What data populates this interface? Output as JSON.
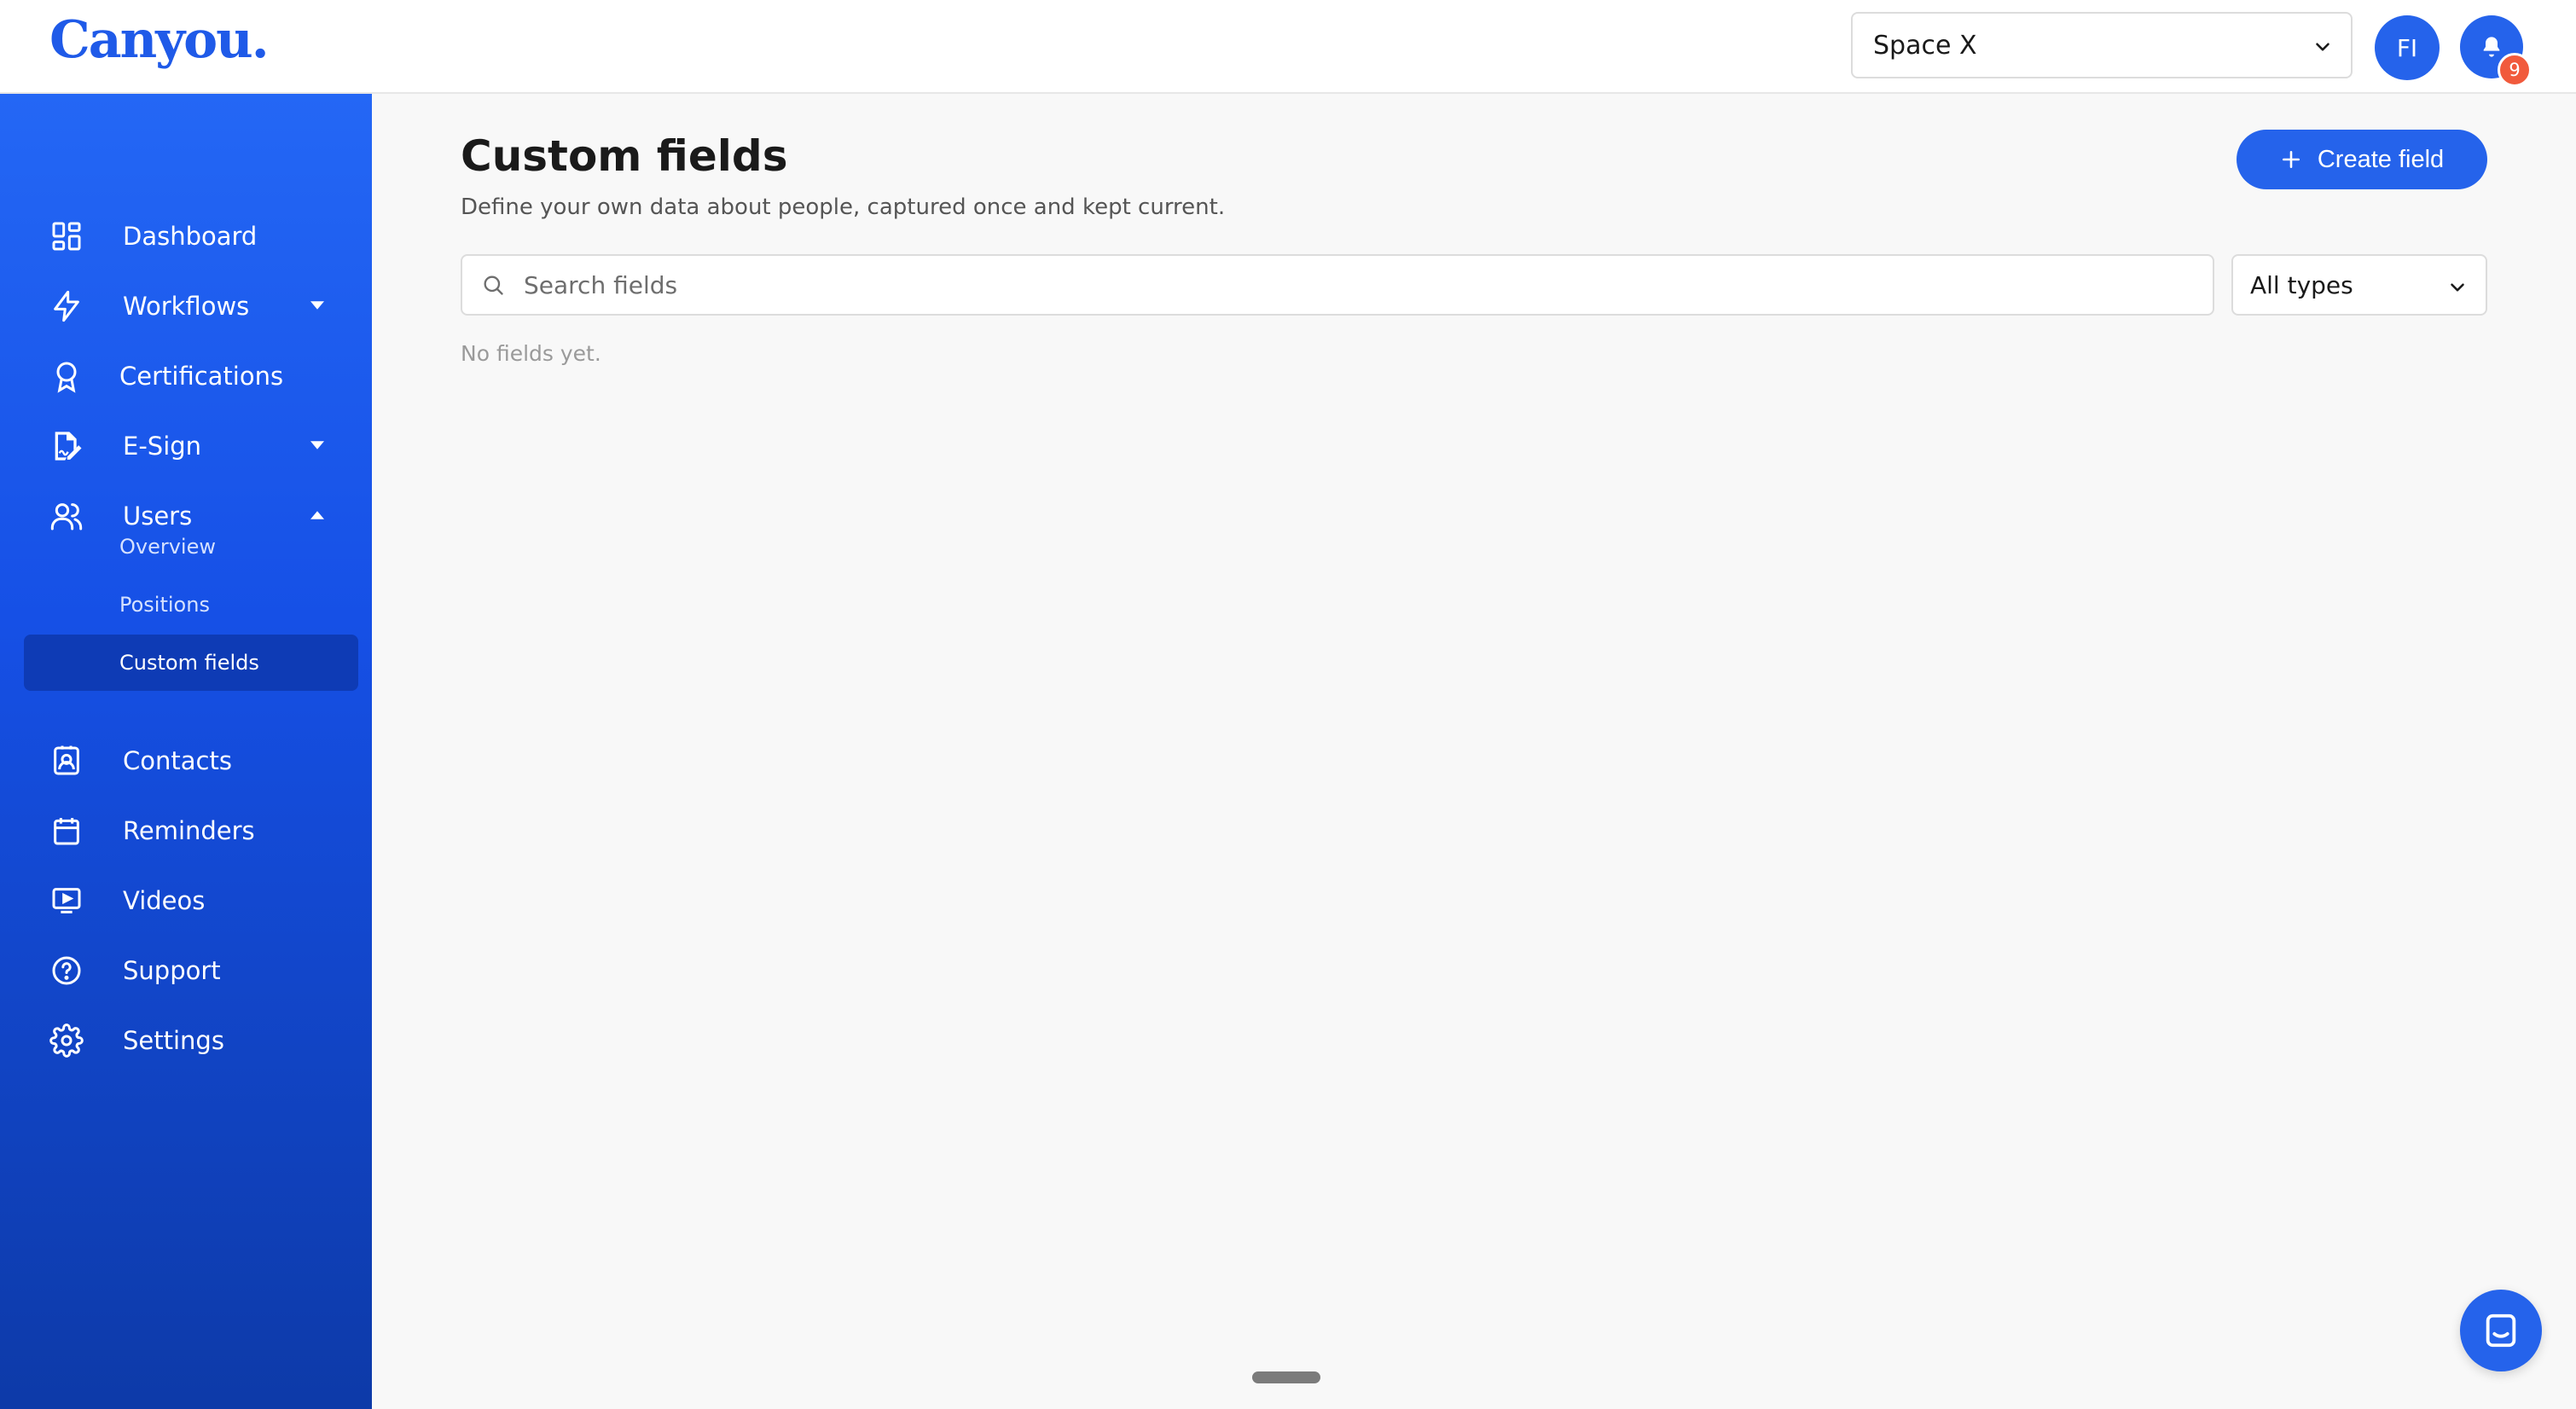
{
  "header": {
    "logo": "Canyou.",
    "space_select": "Space X",
    "avatar_initials": "FI",
    "notifications_count": "9"
  },
  "sidebar": {
    "items": [
      {
        "label": "Dashboard",
        "icon": "dashboard-icon"
      },
      {
        "label": "Workflows",
        "icon": "lightning-icon"
      },
      {
        "label": "Certifications",
        "icon": "award-icon"
      },
      {
        "label": "E-Sign",
        "icon": "signature-icon"
      },
      {
        "label": "Users",
        "icon": "users-icon"
      },
      {
        "label": "Contacts",
        "icon": "contact-card-icon"
      },
      {
        "label": "Reminders",
        "icon": "calendar-icon"
      },
      {
        "label": "Videos",
        "icon": "video-icon"
      },
      {
        "label": "Support",
        "icon": "help-circle-icon"
      },
      {
        "label": "Settings",
        "icon": "gear-icon"
      }
    ],
    "users_subitems": [
      {
        "label": "Overview"
      },
      {
        "label": "Positions"
      },
      {
        "label": "Custom fields",
        "active": true
      }
    ]
  },
  "main": {
    "title": "Custom fields",
    "subtitle": "Define your own data about people, captured once and kept current.",
    "create_button": "Create field",
    "search_placeholder": "Search fields",
    "type_filter": "All types",
    "empty_message": "No fields yet."
  },
  "colors": {
    "accent": "#2563eb",
    "sidebar_active": "#0e3bb5",
    "badge": "#f15a3c"
  }
}
